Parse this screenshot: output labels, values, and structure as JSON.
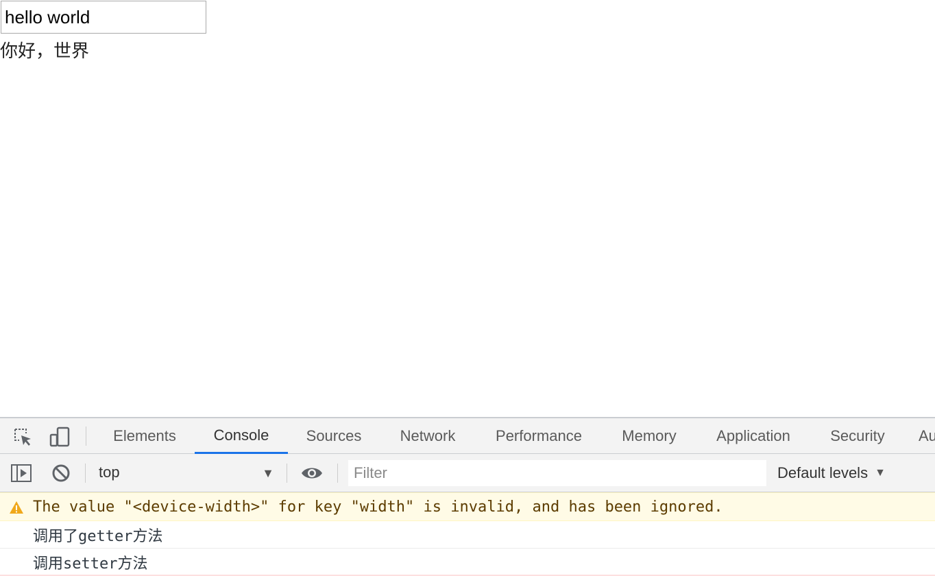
{
  "page": {
    "input_value": "hello world",
    "text": "你好，世界"
  },
  "devtools": {
    "tabs": [
      {
        "label": "Elements"
      },
      {
        "label": "Console"
      },
      {
        "label": "Sources"
      },
      {
        "label": "Network"
      },
      {
        "label": "Performance"
      },
      {
        "label": "Memory"
      },
      {
        "label": "Application"
      },
      {
        "label": "Security"
      },
      {
        "label": "Au"
      }
    ],
    "active_tab": "Console",
    "accent_color": "#1a73e8",
    "icons": {
      "inspect": "inspect-element-icon",
      "device": "device-toolbar-icon",
      "sidebar": "sidebar-toggle-icon",
      "clear": "clear-console-icon",
      "eye": "live-expression-eye-icon"
    },
    "toolbar": {
      "context": "top",
      "filter_placeholder": "Filter",
      "levels": "Default levels"
    },
    "messages": [
      {
        "type": "warning",
        "text": "The value \"<device-width>\" for key \"width\" is invalid, and has been ignored."
      },
      {
        "type": "log",
        "text": "调用了getter方法"
      },
      {
        "type": "log",
        "text": "调用setter方法"
      }
    ]
  }
}
